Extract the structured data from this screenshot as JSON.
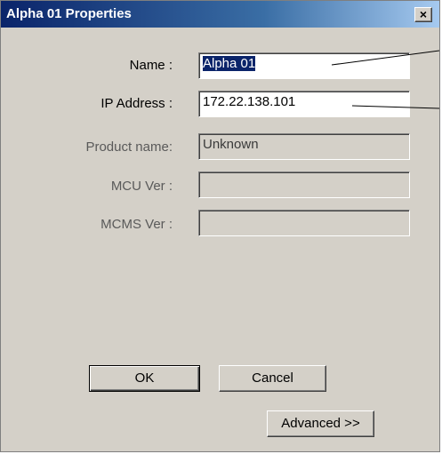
{
  "window": {
    "title": "Alpha 01  Properties",
    "close_glyph": "×"
  },
  "form": {
    "name_label": "Name :",
    "name_value": "Alpha 01",
    "ip_label": "IP Address :",
    "ip_value": "172.22.138.101",
    "product_label": "Product name:",
    "product_value": "Unknown",
    "mcu_label": "MCU Ver :",
    "mcu_value": "",
    "mcms_label": "MCMS Ver :",
    "mcms_value": ""
  },
  "buttons": {
    "ok_label": "OK",
    "cancel_label": "Cancel",
    "advanced_label": "Advanced >>"
  },
  "icons": {
    "close": "close-icon"
  }
}
